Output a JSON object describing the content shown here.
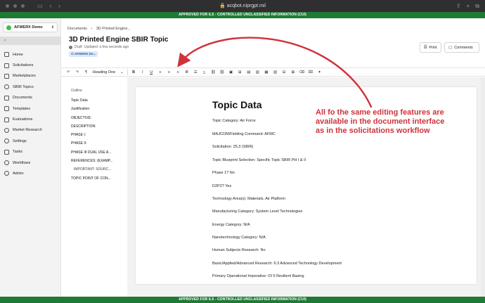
{
  "browser": {
    "url": "acqbot.niprgpt.mil"
  },
  "banner": {
    "top": "APPROVED FOR IL5 - CONTROLLED UNCLASSIFIED INFORMATION (CUI)",
    "bottom": "APPROVED FOR IL5 - CONTROLLED UNCLASSIFIED INFORMATION (CUI)"
  },
  "sidebar": {
    "org": "AFWERX Demo",
    "back": "‹",
    "items": [
      {
        "label": "Home"
      },
      {
        "label": "Solicitations"
      },
      {
        "label": "Marketplaces"
      },
      {
        "label": "SBIR Topics"
      },
      {
        "label": "Documents"
      },
      {
        "label": "Templates"
      },
      {
        "label": "Evaluations"
      },
      {
        "label": "Market Research"
      },
      {
        "label": "Settings"
      },
      {
        "label": "Tasks"
      },
      {
        "label": "Workflows"
      },
      {
        "label": "Admin"
      }
    ]
  },
  "header": {
    "breadcrumb_root": "Documents",
    "breadcrumb_sep": "›",
    "breadcrumb_current": "3D Printed Engine...",
    "title": "3D Printed Engine SBIR Topic",
    "status": "Draft",
    "updated": "Updated: a few seconds ago",
    "tag": "AFWERX De...",
    "print": "Print",
    "comments": "Comments"
  },
  "toolbar": {
    "heading_select": "Heading One"
  },
  "outline": {
    "title": "Outline",
    "items": [
      "Topic Data",
      "Justification",
      "OBJECTIVE:",
      "DESCRIPTION:",
      "PHASE I:",
      "PHASE II:",
      "PHASE III DUAL USE A...",
      "REFERENCES: (EXAMP...",
      "IMPORTANT: SOURC...",
      "TOPIC POINT OF CON..."
    ]
  },
  "document": {
    "heading": "Topic Data",
    "lines": [
      "Topic Category: Air Force",
      "MAJCOM/Fielding Command: AFMC",
      "Solicitation: 25.3 (SBIR)",
      "Topic Blueprint Selection: Specific Topic SBIR PH I & II",
      "Phase 1? No",
      "D2P2? Yes",
      "Technology Area(s): Materials, Air Platform",
      "Manufacturing Category: System Level Technologies",
      "Energy Category: N/A",
      "Nanotechnology Category: N/A",
      "Human Subjects Research: No",
      "Basic/Applied/Advanced Research: 6.3 Advanced Technology Development",
      "Primary Operational Imperative: OI 5 Resilient Basing"
    ]
  },
  "annotation": {
    "text": [
      "All fo the same editing features are",
      "available in the document interface",
      "as in the solicitations workflow"
    ],
    "color": "#d0323a"
  }
}
